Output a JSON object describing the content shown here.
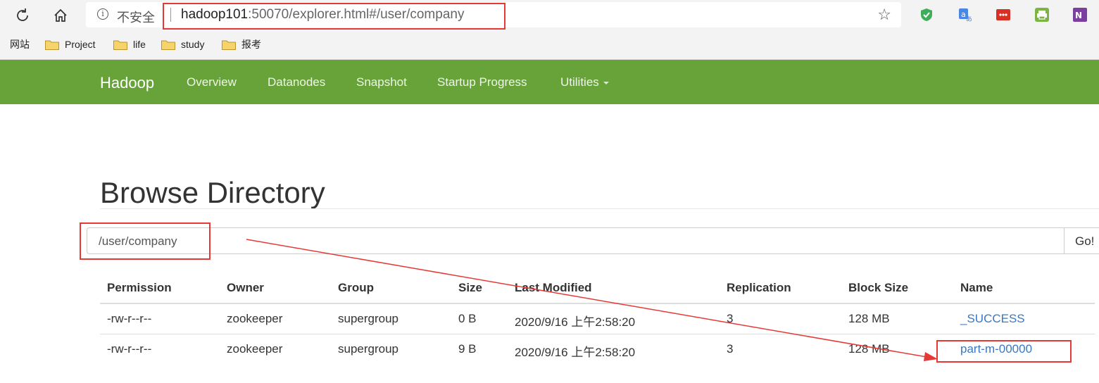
{
  "browser": {
    "insecure_label": "不安全",
    "url_host": "hadoop101",
    "url_rest": ":50070/explorer.html#/user/company",
    "bookmarks": [
      "网站",
      "Project",
      "life",
      "study",
      "报考"
    ]
  },
  "navbar": {
    "brand": "Hadoop",
    "items": [
      "Overview",
      "Datanodes",
      "Snapshot",
      "Startup Progress",
      "Utilities"
    ]
  },
  "page": {
    "title": "Browse Directory",
    "path_value": "/user/company",
    "go_label": "Go!"
  },
  "table": {
    "headers": [
      "Permission",
      "Owner",
      "Group",
      "Size",
      "Last Modified",
      "Replication",
      "Block Size",
      "Name"
    ],
    "rows": [
      [
        "-rw-r--r--",
        "zookeeper",
        "supergroup",
        "0 B",
        "2020/9/16 上午2:58:20",
        "3",
        "128 MB",
        "_SUCCESS"
      ],
      [
        "-rw-r--r--",
        "zookeeper",
        "supergroup",
        "9 B",
        "2020/9/16 上午2:58:20",
        "3",
        "128 MB",
        "part-m-00000"
      ]
    ]
  },
  "colors": {
    "navbar": "#68a33a",
    "annotation": "#e53935",
    "link": "#3a78c0"
  }
}
